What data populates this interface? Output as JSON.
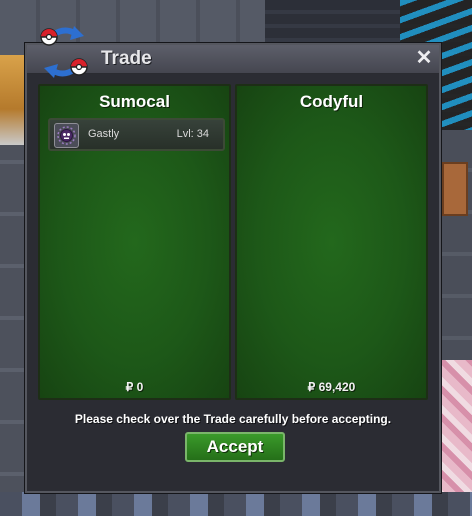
{
  "window": {
    "title": "Trade",
    "close_label": "✕"
  },
  "left_trader": {
    "name": "Sumocal",
    "money": "₽ 0",
    "offered_pokemon": [
      {
        "name": "Gastly",
        "level": "Lvl: 34",
        "icon": "gastly-icon"
      }
    ]
  },
  "right_trader": {
    "name": "Codyful",
    "money": "₽ 69,420"
  },
  "notice": "Please check over the Trade carefully before accepting.",
  "accept_label": "Accept",
  "colors": {
    "panel_green": "#1d5818",
    "accept_green": "#2f8522",
    "window_bg": "#2b2c33"
  }
}
